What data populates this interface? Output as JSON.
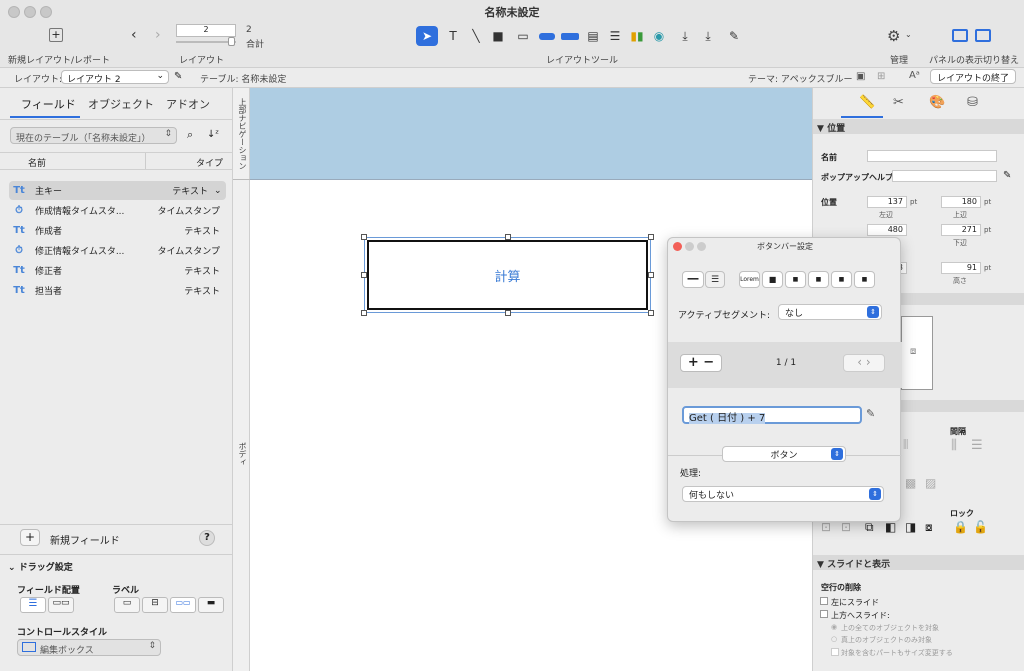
{
  "window": {
    "title": "名称未設定"
  },
  "toolbar": {
    "new_layout_label": "新規レイアウト/レポート",
    "record_field_value": "2",
    "total_value": "2",
    "total_label": "合計",
    "layout_label": "レイアウト",
    "layout_tools_label": "レイアウトツール",
    "manage_label": "管理",
    "panel_toggle_label": "パネルの表示切り替え"
  },
  "layoutbar": {
    "layout_prefix": "レイアウト:",
    "layout_name": "レイアウト 2",
    "table_text": "テーブル: 名称未設定",
    "theme_text": "テーマ: アペックスブルー",
    "exit_button": "レイアウトの終了"
  },
  "left_panel": {
    "tabs": [
      "フィールド",
      "オブジェクト",
      "アドオン"
    ],
    "table_selector": "現在のテーブル（「名称未設定」）",
    "col_name": "名前",
    "col_type": "タイプ",
    "fields": [
      {
        "icon": "Tt",
        "name": "主キー",
        "type": "テキスト"
      },
      {
        "icon": "⏱",
        "name": "作成情報タイムスタ...",
        "type": "タイムスタンプ"
      },
      {
        "icon": "Tt",
        "name": "作成者",
        "type": "テキスト"
      },
      {
        "icon": "⏱",
        "name": "修正情報タイムスタ...",
        "type": "タイムスタンプ"
      },
      {
        "icon": "Tt",
        "name": "修正者",
        "type": "テキスト"
      },
      {
        "icon": "Tt",
        "name": "担当者",
        "type": "テキスト"
      }
    ],
    "new_field_label": "新規フィールド",
    "help_label": "?",
    "drag_settings_label": "ドラッグ設定",
    "field_placement_label": "フィールド配置",
    "label_label": "ラベル",
    "control_style_label": "コントロールスタイル",
    "control_style_value": "編集ボックス"
  },
  "strip": {
    "top_label": "上部ナビゲーション",
    "body_label": "ボディ"
  },
  "canvas": {
    "button_label": "計算"
  },
  "popover": {
    "title": "ボタンバー設定",
    "active_segment_label": "アクティブセグメント:",
    "active_segment_value": "なし",
    "page_indicator": "1 / 1",
    "calc_value": "Get ( 日付 ) + 7",
    "type_value": "ボタン",
    "action_label": "処理:",
    "action_value": "何もしない"
  },
  "right_panel": {
    "position_section": "位置",
    "name_label": "名前",
    "popup_help_label": "ポップアップヘルプ",
    "position_label": "位置",
    "left_value": "137",
    "top_value": "180",
    "right_value": "480",
    "bottom_value": "271",
    "width_value": "3",
    "height_value": "91",
    "unit": "pt",
    "left_label": "左辺",
    "top_label": "上辺",
    "bottom_label": "下辺",
    "height_label": "高さ",
    "spacing_label": "間隔",
    "lock_label": "ロック",
    "slide_section": "スライドと表示",
    "remove_space_label": "空行の削除",
    "slide_left_label": "左にスライド",
    "slide_up_label": "上方へスライド:",
    "opt_all_above": "上の全てのオブジェクトを対象",
    "opt_directly_above": "真上のオブジェクトのみ対象",
    "opt_resize_part": "対象を含むパートもサイズ変更する"
  },
  "colors": {
    "accent": "#2f6fdd",
    "header_part": "#aecde3",
    "button_text": "#3a7bd5"
  }
}
